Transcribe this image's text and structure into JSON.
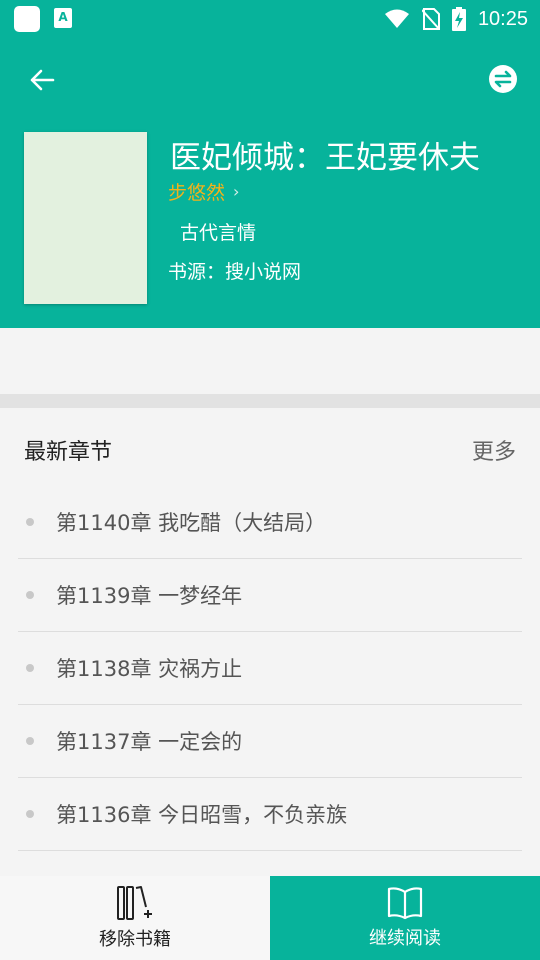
{
  "status_bar": {
    "time": "10:25",
    "app_icon_letter": "A",
    "icons": [
      "app-square-icon",
      "app-notification-icon",
      "wifi-icon",
      "no-sim-icon",
      "battery-charging-icon"
    ]
  },
  "toolbar": {
    "back_icon": "arrow-left-icon",
    "swap_icon": "swap-source-icon"
  },
  "book": {
    "title": "医妃倾城：王妃要休夫",
    "author": "步悠然",
    "author_chevron": "›",
    "category": "古代言情",
    "source_label": "书源：",
    "source_name": "搜小说网"
  },
  "chapters": {
    "section_title": "最新章节",
    "more_label": "更多",
    "items": [
      "第1140章 我吃醋（大结局）",
      "第1139章 一梦经年",
      "第1138章 灾祸方止",
      "第1137章 一定会的",
      "第1136章 今日昭雪，不负亲族"
    ]
  },
  "bottom_bar": {
    "remove_label": "移除书籍",
    "continue_label": "继续阅读"
  },
  "colors": {
    "primary": "#07b39b",
    "author": "#f2b21a",
    "background": "#f4f4f4"
  }
}
